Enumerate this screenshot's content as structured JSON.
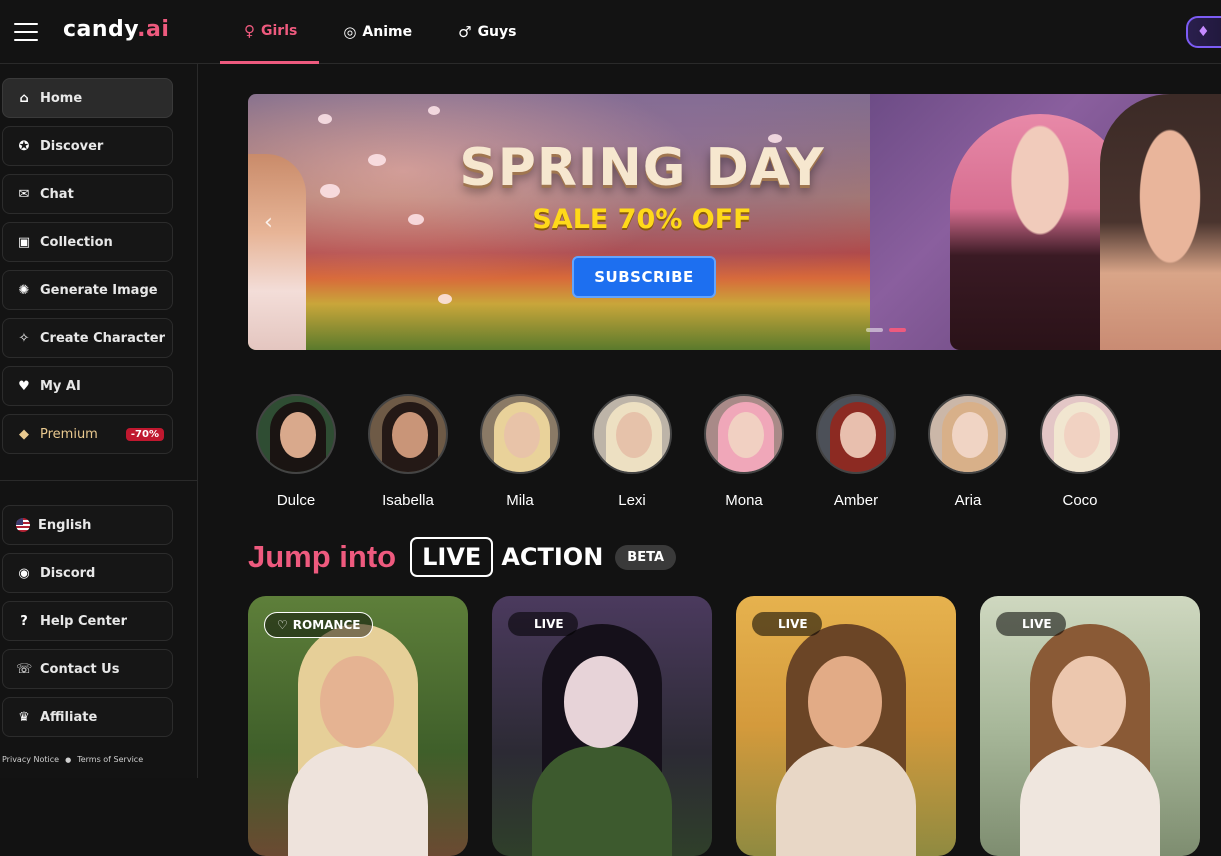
{
  "header": {
    "logo_brand": "candy",
    "logo_suffix": ".ai",
    "tabs": [
      {
        "label": "Girls",
        "icon": "female-icon",
        "glyph": "♀",
        "active": true
      },
      {
        "label": "Anime",
        "icon": "anime-swirl-icon",
        "glyph": "◎",
        "active": false
      },
      {
        "label": "Guys",
        "icon": "male-icon",
        "glyph": "♂",
        "active": false
      }
    ],
    "premium_glyph": "♦",
    "accent_color": "#ee5a7e"
  },
  "sidebar": {
    "items": [
      {
        "label": "Home",
        "icon": "home-icon",
        "glyph": "⌂",
        "active": true
      },
      {
        "label": "Discover",
        "icon": "compass-icon",
        "glyph": "✪"
      },
      {
        "label": "Chat",
        "icon": "chat-icon",
        "glyph": "✉"
      },
      {
        "label": "Collection",
        "icon": "gallery-icon",
        "glyph": "▣"
      },
      {
        "label": "Generate Image",
        "icon": "generate-image-icon",
        "glyph": "✺"
      },
      {
        "label": "Create Character",
        "icon": "magic-wand-icon",
        "glyph": "✧"
      },
      {
        "label": "My AI",
        "icon": "hearts-icon",
        "glyph": "♥"
      },
      {
        "label": "Premium",
        "icon": "diamond-icon",
        "glyph": "◆",
        "badge": "-70%"
      }
    ],
    "secondary": [
      {
        "label": "English",
        "icon": "us-flag-icon"
      },
      {
        "label": "Discord",
        "icon": "discord-icon",
        "glyph": "◉"
      },
      {
        "label": "Help Center",
        "icon": "help-icon",
        "glyph": "?"
      },
      {
        "label": "Contact Us",
        "icon": "handshake-icon",
        "glyph": "☏"
      },
      {
        "label": "Affiliate",
        "icon": "trophy-icon",
        "glyph": "♛"
      }
    ],
    "legal": {
      "privacy": "Privacy Notice",
      "terms": "Terms of Service",
      "separator": "●"
    }
  },
  "banner": {
    "title": "SPRING DAY",
    "subtitle": "SALE 70% OFF",
    "cta": "SUBSCRIBE",
    "prev_glyph": "‹",
    "slides_total": 2,
    "active_slide": 2
  },
  "characters": [
    {
      "name": "Dulce",
      "hair": "#1a1412",
      "skin": "#d9a98c",
      "bg": "#2f4d33"
    },
    {
      "name": "Isabella",
      "hair": "#241916",
      "skin": "#c99578",
      "bg": "#6e5a46"
    },
    {
      "name": "Mila",
      "hair": "#e9d29a",
      "skin": "#e8c3a8",
      "bg": "#8a7a66"
    },
    {
      "name": "Lexi",
      "hair": "#ede0c2",
      "skin": "#e6c2aa",
      "bg": "#bdb4a8"
    },
    {
      "name": "Mona",
      "hair": "#f0a7b9",
      "skin": "#f1d0c2",
      "bg": "#a98a88"
    },
    {
      "name": "Amber",
      "hair": "#8c2a22",
      "skin": "#e8bfae",
      "bg": "#4c5058"
    },
    {
      "name": "Aria",
      "hair": "#d8b089",
      "skin": "#f0d4c4",
      "bg": "#cbb7a8"
    },
    {
      "name": "Coco",
      "hair": "#f1e6d0",
      "skin": "#f1d2c2",
      "bg": "#e3c6c6"
    }
  ],
  "live_section": {
    "jump": "Jump into",
    "live": "LIVE",
    "action": "ACTION",
    "beta": "BETA"
  },
  "cards": [
    {
      "badge": "ROMANCE",
      "badge_type": "romance",
      "badge_icon": "heart-outline-icon",
      "hair": "#e6cf98",
      "skin": "#e5b392",
      "body": "#eee3dc",
      "bg": "linear-gradient(180deg,#5e7f3a,#3f5f2a 60%,#6b4a32)"
    },
    {
      "badge": "LIVE",
      "badge_type": "live",
      "hair": "#15101a",
      "skin": "#e7d3d8",
      "body": "#3d5a2e",
      "bg": "linear-gradient(180deg,#4b3a5e,#2c2a34 60%,#2f3f2a)"
    },
    {
      "badge": "LIVE",
      "badge_type": "live",
      "hair": "#6b4526",
      "skin": "#e2ab86",
      "body": "#e8d7c6",
      "bg": "linear-gradient(180deg,#e6b24e,#d49a3c 50%,#8f8a40)"
    },
    {
      "badge": "LIVE",
      "badge_type": "live",
      "hair": "#8a5a36",
      "skin": "#ecc7ae",
      "body": "#efe6de",
      "bg": "linear-gradient(180deg,#cfd8c0,#a8b89a 50%,#7e8d70)"
    }
  ]
}
